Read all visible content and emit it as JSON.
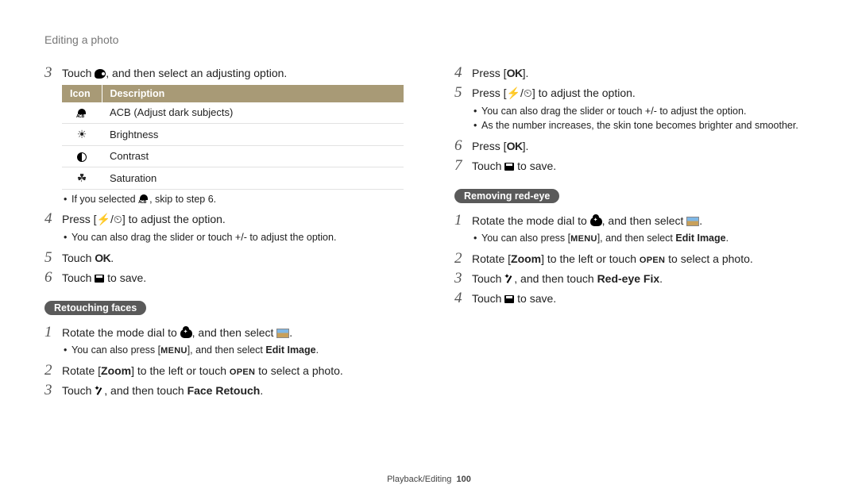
{
  "page_title": "Editing a photo",
  "footer": {
    "section": "Playback/Editing",
    "page": "100"
  },
  "table": {
    "headers": {
      "icon": "Icon",
      "desc": "Description"
    },
    "rows": [
      {
        "icon": "acb",
        "desc": "ACB (Adjust dark subjects)"
      },
      {
        "icon": "brightness",
        "desc": "Brightness"
      },
      {
        "icon": "contrast",
        "desc": "Contrast"
      },
      {
        "icon": "saturation",
        "desc": "Saturation"
      }
    ]
  },
  "left": {
    "s3": {
      "n": "3",
      "pre": "Touch ",
      "post": ", and then select an adjusting option."
    },
    "s3_note1_pre": "If you selected ",
    "s3_note1_post": ", skip to step 6.",
    "s4": {
      "n": "4",
      "pre": "Press [",
      "mid": "/",
      "post": "] to adjust the option."
    },
    "s4_note1": "You can also drag the slider or touch +/- to adjust the option.",
    "s5": {
      "n": "5",
      "pre": "Touch ",
      "ok": "OK",
      "post": "."
    },
    "s6": {
      "n": "6",
      "pre": "Touch ",
      "post": " to save."
    },
    "sub": "Retouching faces",
    "r1": {
      "n": "1",
      "pre": "Rotate the mode dial to ",
      "mid": ", and then select ",
      "post": "."
    },
    "r1_note_pre": "You can also press [",
    "r1_note_menu": "MENU",
    "r1_note_mid": "], and then select ",
    "r1_note_bold": "Edit Image",
    "r1_note_post": ".",
    "r2": {
      "n": "2",
      "pre": "Rotate [",
      "zoom": "Zoom",
      "mid": "] to the left or touch ",
      "open": "OPEN",
      "post": " to select a photo."
    },
    "r3": {
      "n": "3",
      "pre": "Touch ",
      "mid": ", and then touch ",
      "bold": "Face Retouch",
      "post": "."
    }
  },
  "right": {
    "s4": {
      "n": "4",
      "pre": "Press [",
      "ok": "OK",
      "post": "]."
    },
    "s5": {
      "n": "5",
      "pre": "Press [",
      "mid": "/",
      "post": "] to adjust the option."
    },
    "s5_note1": "You can also drag the slider or touch +/- to adjust the option.",
    "s5_note2": "As the number increases, the skin tone becomes brighter and smoother.",
    "s6": {
      "n": "6",
      "pre": "Press [",
      "ok": "OK",
      "post": "]."
    },
    "s7": {
      "n": "7",
      "pre": "Touch ",
      "post": " to save."
    },
    "sub": "Removing red-eye",
    "r1": {
      "n": "1",
      "pre": "Rotate the mode dial to ",
      "mid": ", and then select ",
      "post": "."
    },
    "r1_note_pre": "You can also press [",
    "r1_note_menu": "MENU",
    "r1_note_mid": "], and then select ",
    "r1_note_bold": "Edit Image",
    "r1_note_post": ".",
    "r2": {
      "n": "2",
      "pre": "Rotate [",
      "zoom": "Zoom",
      "mid": "] to the left or touch ",
      "open": "OPEN",
      "post": " to select a photo."
    },
    "r3": {
      "n": "3",
      "pre": "Touch ",
      "mid": ", and then touch ",
      "bold": "Red-eye Fix",
      "post": "."
    },
    "r4": {
      "n": "4",
      "pre": "Touch ",
      "post": " to save."
    }
  }
}
